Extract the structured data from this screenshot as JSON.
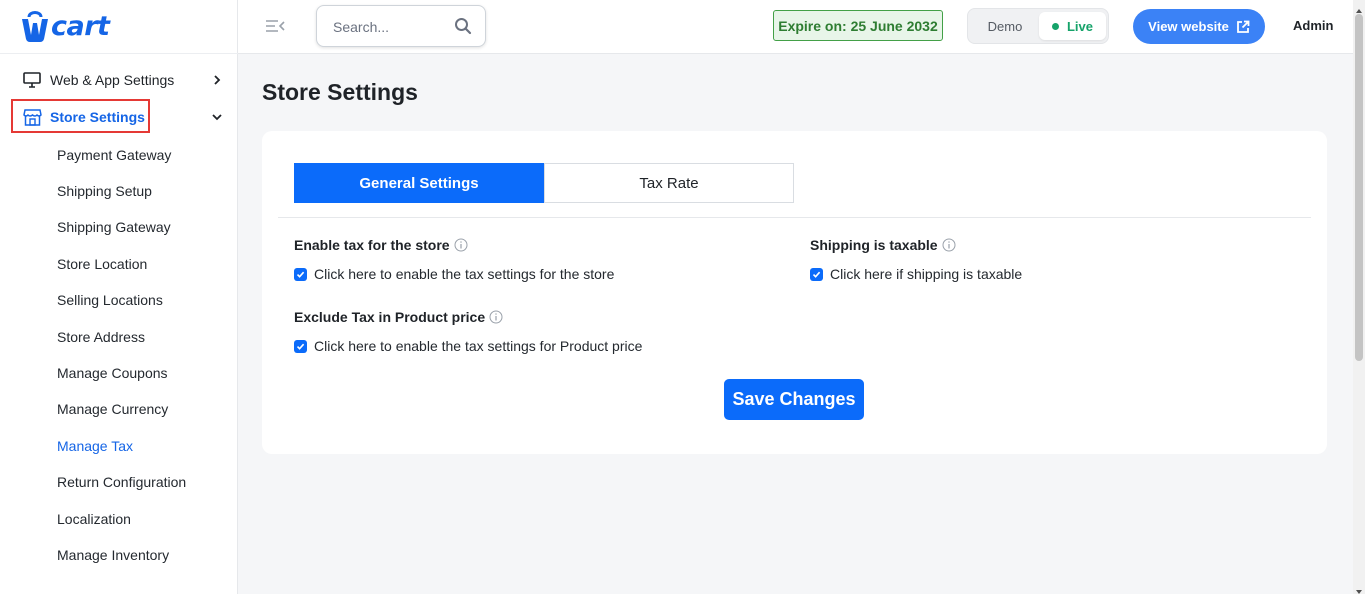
{
  "brand": {
    "logo_text": "cart",
    "accent_color": "#0b6bfa"
  },
  "sidebar": {
    "sections": [
      {
        "label": "Web & App Settings",
        "icon": "monitor-icon",
        "expanded": false
      },
      {
        "label": "Store Settings",
        "icon": "storefront-icon",
        "expanded": true
      }
    ],
    "items": [
      {
        "label": "Payment Gateway"
      },
      {
        "label": "Shipping Setup"
      },
      {
        "label": "Shipping Gateway"
      },
      {
        "label": "Store Location"
      },
      {
        "label": "Selling Locations"
      },
      {
        "label": "Store Address"
      },
      {
        "label": "Manage Coupons"
      },
      {
        "label": "Manage Currency"
      },
      {
        "label": "Manage Tax",
        "active": true
      },
      {
        "label": "Return Configuration"
      },
      {
        "label": "Localization"
      },
      {
        "label": "Manage Inventory"
      }
    ]
  },
  "topbar": {
    "search_placeholder": "Search...",
    "expire_text": "Expire on: 25 June 2032",
    "mode": {
      "demo_label": "Demo",
      "live_label": "Live",
      "selected": "Live"
    },
    "view_website_label": "View website",
    "user_label": "Admin"
  },
  "main": {
    "title": "Store Settings",
    "tabs": [
      {
        "label": "General Settings",
        "active": true
      },
      {
        "label": "Tax Rate",
        "active": false
      }
    ],
    "fields": {
      "enable_tax": {
        "label": "Enable tax for the store",
        "checkbox_label": "Click here to enable the tax settings for the store",
        "checked": true
      },
      "shipping_taxable": {
        "label": "Shipping is taxable",
        "checkbox_label": "Click here if shipping is taxable",
        "checked": true
      },
      "exclude_tax": {
        "label": "Exclude Tax in Product price",
        "checkbox_label": "Click here to enable the tax settings for Product price",
        "checked": true
      }
    },
    "save_label": "Save Changes"
  }
}
